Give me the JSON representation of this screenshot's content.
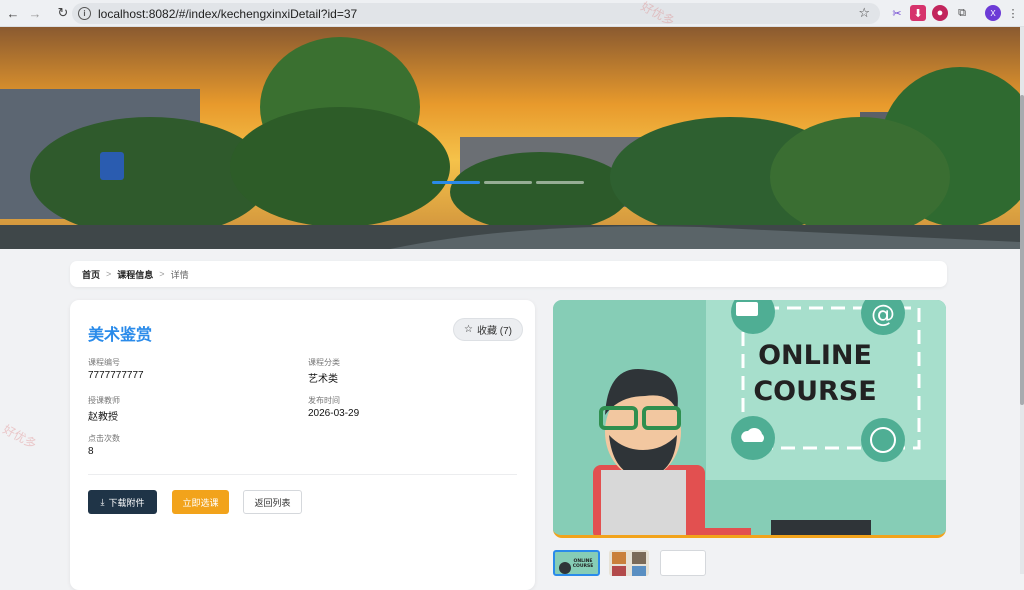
{
  "browser": {
    "url": "localhost:8082/#/index/kechengxinxiDetail?id=37",
    "profile_initial": "X"
  },
  "breadcrumb": {
    "home": "首页",
    "section": "课程信息",
    "current": "详情",
    "sep": ">"
  },
  "course": {
    "title": "美术鉴赏",
    "favorite_label": "收藏 (7)",
    "fields": {
      "code_label": "课程编号",
      "code": "7777777777",
      "category_label": "课程分类",
      "category": "艺术类",
      "teacher_label": "授课教师",
      "teacher": "赵教授",
      "date_label": "发布时间",
      "date": "2026-03-29",
      "clicks_label": "点击次数",
      "clicks": "8"
    },
    "buttons": {
      "download": "下载附件",
      "enroll": "立即选课",
      "back": "返回列表"
    }
  },
  "image": {
    "line1": "ONLINE",
    "line2": "COURSE"
  },
  "thumbs": {
    "t1a": "ONLINE",
    "t1b": "COURSE"
  },
  "watermark": "好优多",
  "colors": {
    "accent": "#2a8bea",
    "dark_button": "#1f3447",
    "orange": "#f2a31b",
    "teal": "#86cdb6"
  }
}
